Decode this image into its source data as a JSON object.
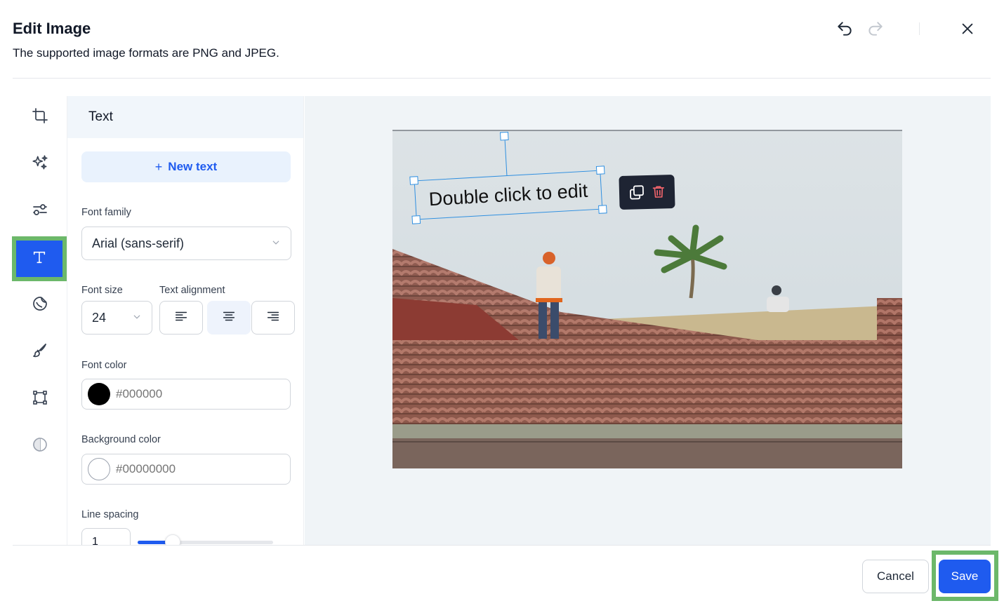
{
  "header": {
    "title": "Edit Image",
    "subtitle": "The supported image formats are PNG and JPEG."
  },
  "toolbar": {
    "tools": [
      {
        "icon": "crop-icon"
      },
      {
        "icon": "sparkles-icon"
      },
      {
        "icon": "adjust-icon"
      },
      {
        "icon": "text-icon",
        "active": true
      },
      {
        "icon": "sticker-icon"
      },
      {
        "icon": "brush-icon"
      },
      {
        "icon": "frame-icon"
      },
      {
        "icon": "contrast-icon"
      }
    ]
  },
  "panel": {
    "title": "Text",
    "new_text_label": "New text",
    "font_family_label": "Font family",
    "font_family_value": "Arial (sans-serif)",
    "font_size_label": "Font size",
    "font_size_value": "24",
    "text_alignment_label": "Text alignment",
    "alignment_selected": "center",
    "font_color_label": "Font color",
    "font_color_value": "#000000",
    "background_color_label": "Background color",
    "background_color_value": "#00000000",
    "line_spacing_label": "Line spacing",
    "line_spacing_value": "1",
    "line_spacing_fraction": 0.2
  },
  "canvas": {
    "text_box_content": "Double click to edit"
  },
  "footer": {
    "cancel_label": "Cancel",
    "save_label": "Save"
  },
  "colors": {
    "accent": "#1f5bef",
    "highlight_outline": "#6cb86a",
    "selection": "#2f8fe0"
  }
}
